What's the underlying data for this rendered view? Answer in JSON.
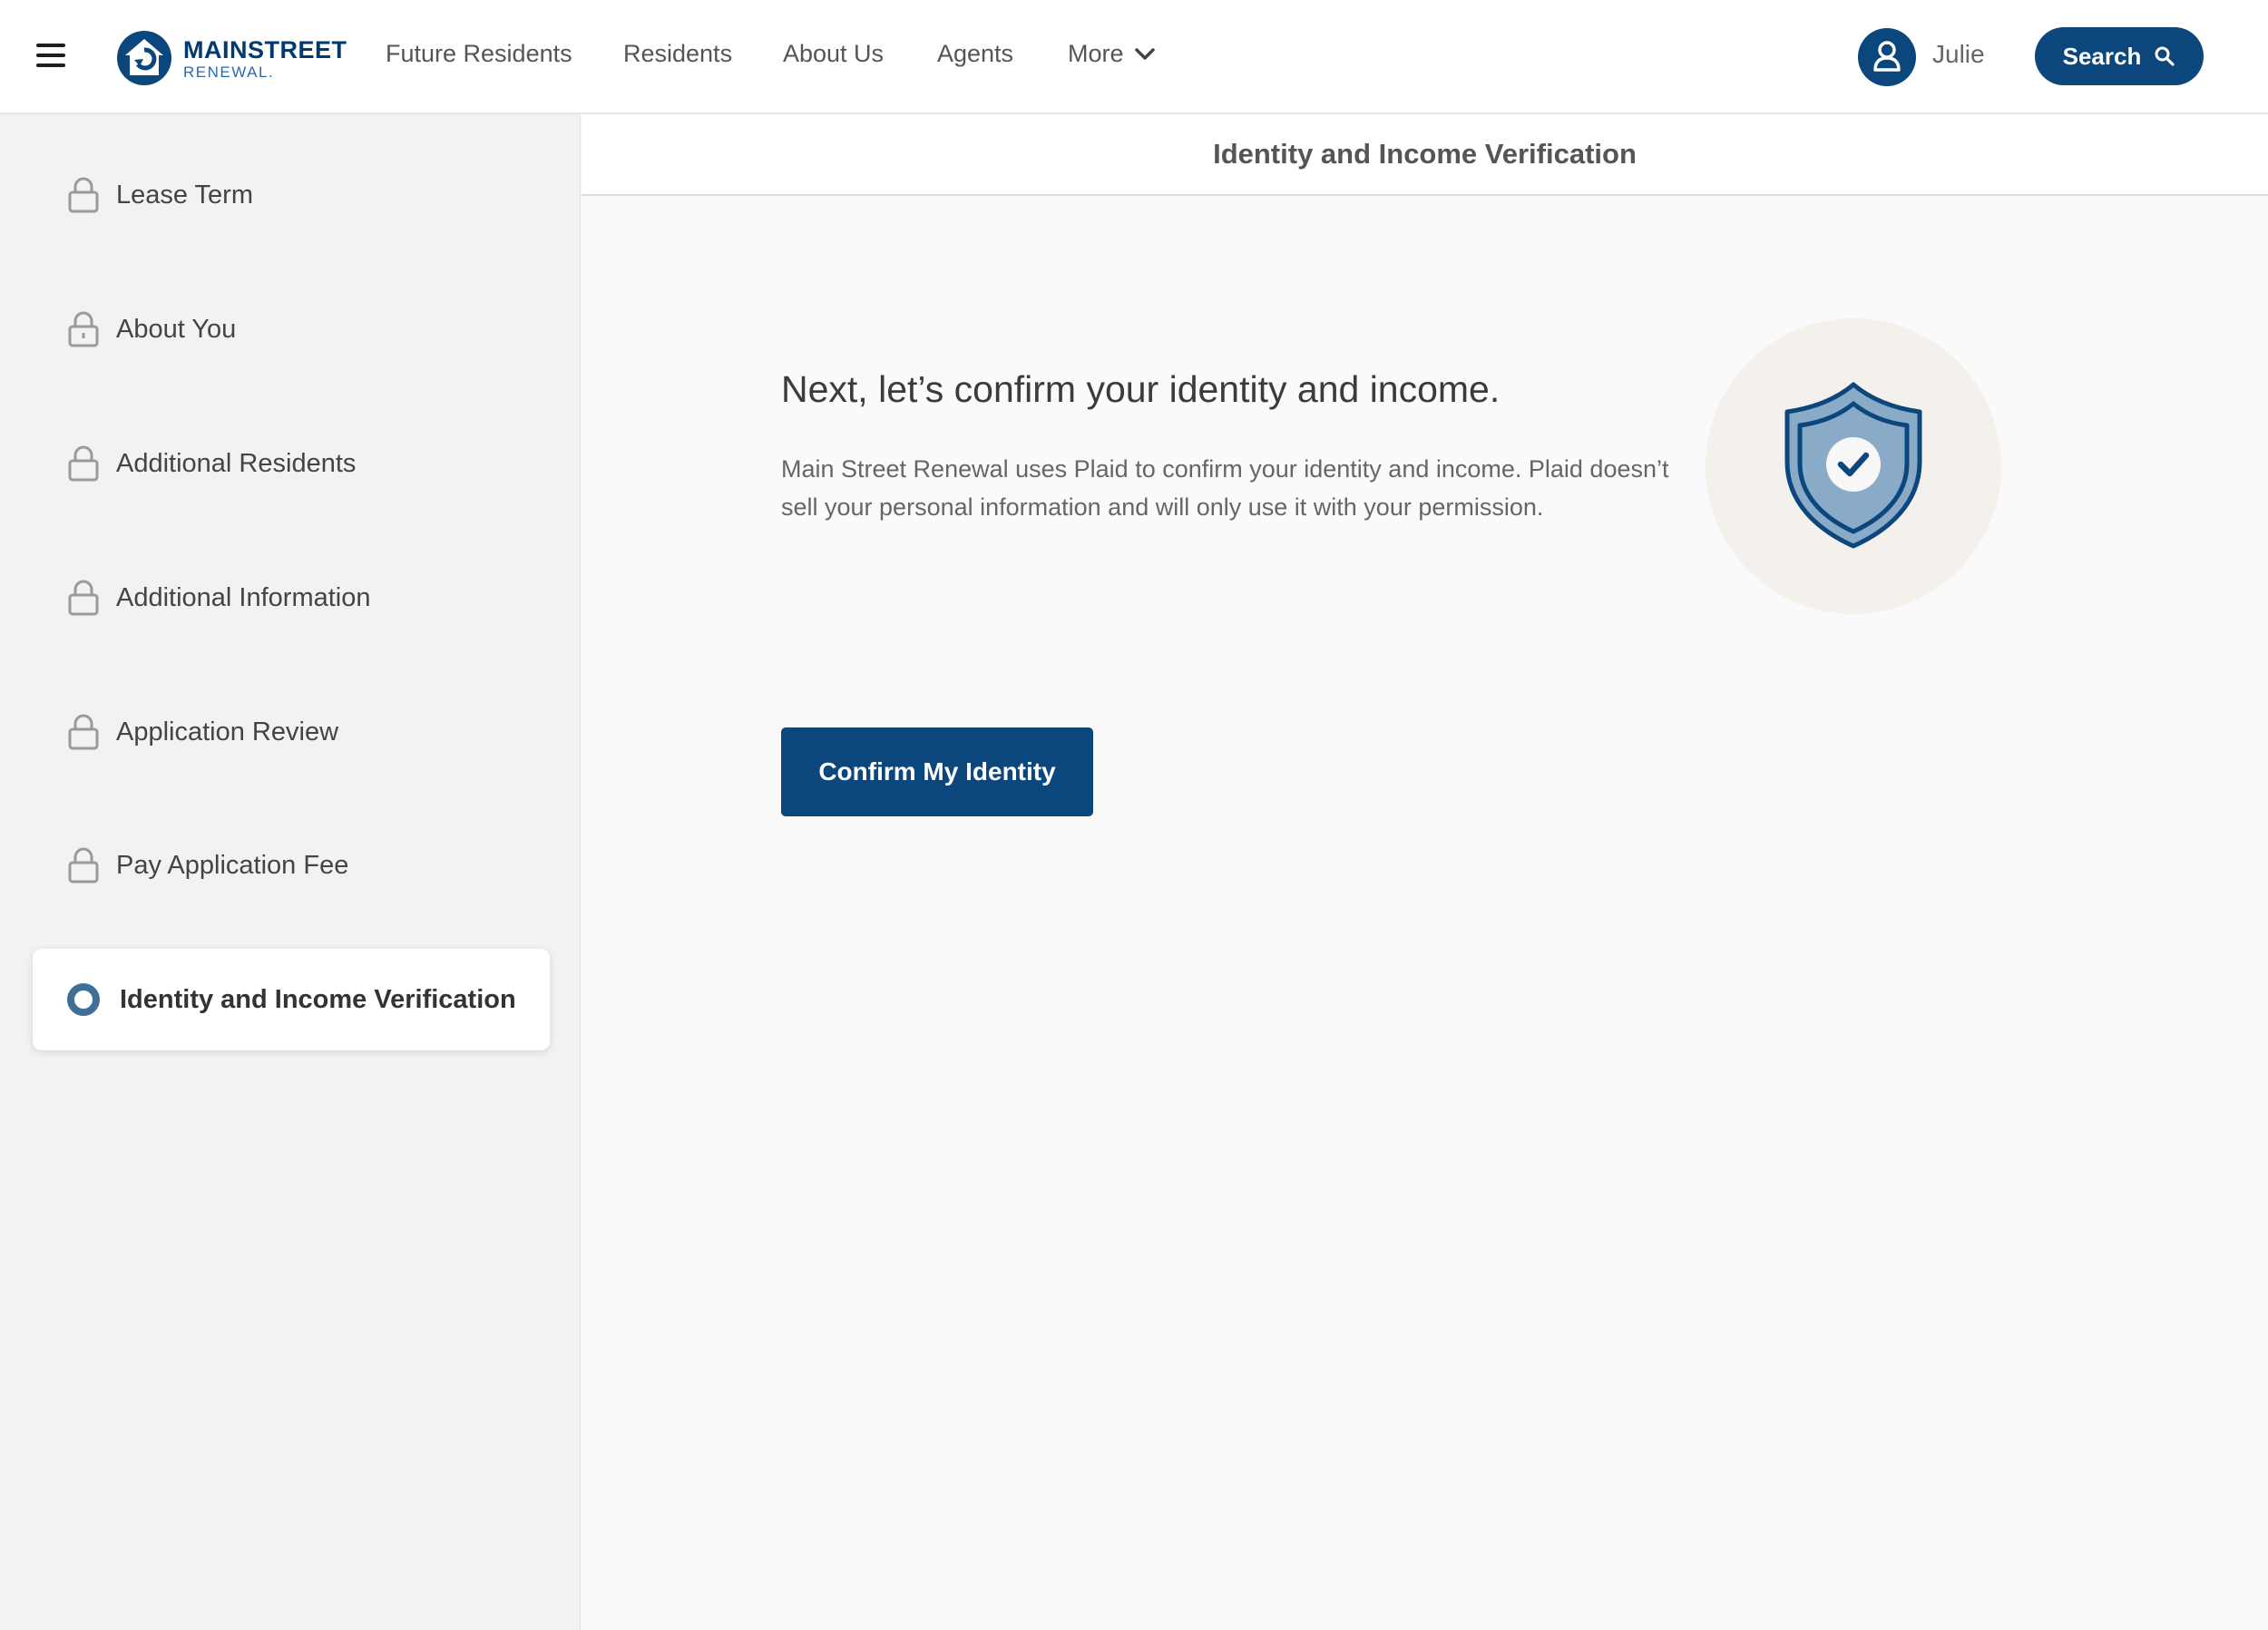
{
  "header": {
    "logo_line1": "MAINSTREET",
    "logo_line2": "RENEWAL.",
    "nav": [
      {
        "label": "Future Residents"
      },
      {
        "label": "Residents"
      },
      {
        "label": "About Us"
      },
      {
        "label": "Agents"
      },
      {
        "label": "More"
      }
    ],
    "user_name": "Julie",
    "search_label": "Search"
  },
  "sidebar": {
    "steps": [
      {
        "label": "Lease Term",
        "state": "locked"
      },
      {
        "label": "About You",
        "state": "locked"
      },
      {
        "label": "Additional Residents",
        "state": "locked"
      },
      {
        "label": "Additional Information",
        "state": "locked"
      },
      {
        "label": "Application Review",
        "state": "locked"
      },
      {
        "label": "Pay Application Fee",
        "state": "locked"
      },
      {
        "label": "Identity and Income Verification",
        "state": "active"
      }
    ]
  },
  "main": {
    "title": "Identity and Income Verification",
    "headline": "Next, let’s confirm your identity and income.",
    "body": "Main Street Renewal uses Plaid to confirm your identity and income. Plaid doesn’t sell your personal information and will only use it with your permission.",
    "confirm_label": "Confirm My Identity"
  },
  "colors": {
    "brand_navy": "#0b467d",
    "sidebar_bg": "#f2f2f2",
    "illustration_circle": "#f4f1ed",
    "shield_light": "#8aabc7"
  },
  "icons": [
    "menu-icon",
    "house-logo-icon",
    "chevron-down-icon",
    "user-icon",
    "search-icon",
    "lock-icon",
    "shield-check-icon"
  ]
}
